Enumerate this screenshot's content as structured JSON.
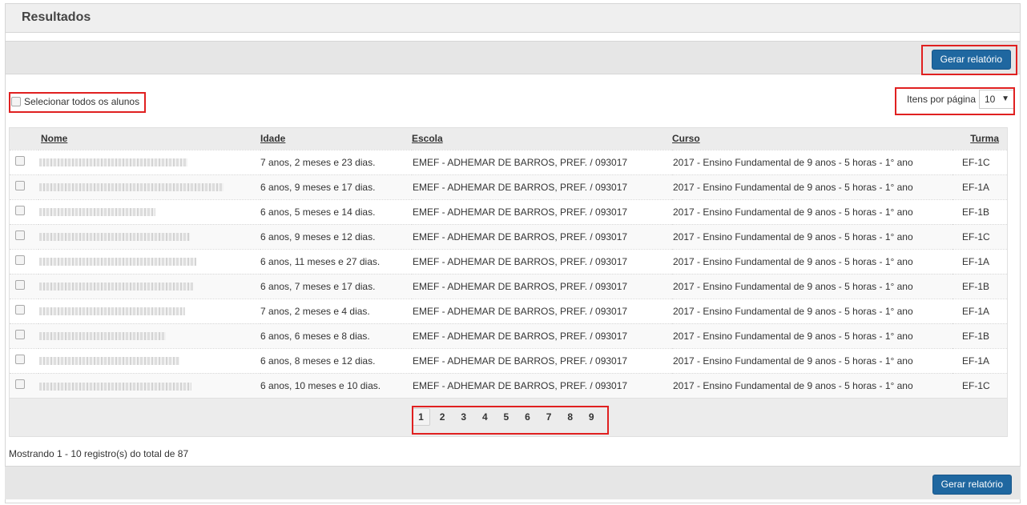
{
  "panel": {
    "title": "Resultados"
  },
  "toolbar": {
    "generate_label": "Gerar relatório"
  },
  "select_all": {
    "label": "Selecionar todos os alunos"
  },
  "per_page": {
    "label": "Itens por página",
    "value": "10"
  },
  "table": {
    "headers": {
      "nome": "Nome",
      "idade": "Idade",
      "escola": "Escola",
      "curso": "Curso",
      "turma": "Turma"
    },
    "rows": [
      {
        "idade": "7 anos, 2 meses e 23 dias.",
        "escola": "EMEF - ADHEMAR DE BARROS, PREF. / 093017",
        "curso": "2017 - Ensino Fundamental de 9 anos - 5 horas - 1° ano",
        "turma": "EF-1C"
      },
      {
        "idade": "6 anos, 9 meses e 17 dias.",
        "escola": "EMEF - ADHEMAR DE BARROS, PREF. / 093017",
        "curso": "2017 - Ensino Fundamental de 9 anos - 5 horas - 1° ano",
        "turma": "EF-1A"
      },
      {
        "idade": "6 anos, 5 meses e 14 dias.",
        "escola": "EMEF - ADHEMAR DE BARROS, PREF. / 093017",
        "curso": "2017 - Ensino Fundamental de 9 anos - 5 horas - 1° ano",
        "turma": "EF-1B"
      },
      {
        "idade": "6 anos, 9 meses e 12 dias.",
        "escola": "EMEF - ADHEMAR DE BARROS, PREF. / 093017",
        "curso": "2017 - Ensino Fundamental de 9 anos - 5 horas - 1° ano",
        "turma": "EF-1C"
      },
      {
        "idade": "6 anos, 11 meses e 27 dias.",
        "escola": "EMEF - ADHEMAR DE BARROS, PREF. / 093017",
        "curso": "2017 - Ensino Fundamental de 9 anos - 5 horas - 1° ano",
        "turma": "EF-1A"
      },
      {
        "idade": "6 anos, 7 meses e 17 dias.",
        "escola": "EMEF - ADHEMAR DE BARROS, PREF. / 093017",
        "curso": "2017 - Ensino Fundamental de 9 anos - 5 horas - 1° ano",
        "turma": "EF-1B"
      },
      {
        "idade": "7 anos, 2 meses e 4 dias.",
        "escola": "EMEF - ADHEMAR DE BARROS, PREF. / 093017",
        "curso": "2017 - Ensino Fundamental de 9 anos - 5 horas - 1° ano",
        "turma": "EF-1A"
      },
      {
        "idade": "6 anos, 6 meses e 8 dias.",
        "escola": "EMEF - ADHEMAR DE BARROS, PREF. / 093017",
        "curso": "2017 - Ensino Fundamental de 9 anos - 5 horas - 1° ano",
        "turma": "EF-1B"
      },
      {
        "idade": "6 anos, 8 meses e 12 dias.",
        "escola": "EMEF - ADHEMAR DE BARROS, PREF. / 093017",
        "curso": "2017 - Ensino Fundamental de 9 anos - 5 horas - 1° ano",
        "turma": "EF-1A"
      },
      {
        "idade": "6 anos, 10 meses e 10 dias.",
        "escola": "EMEF - ADHEMAR DE BARROS, PREF. / 093017",
        "curso": "2017 - Ensino Fundamental de 9 anos - 5 horas - 1° ano",
        "turma": "EF-1C"
      }
    ]
  },
  "pagination": {
    "pages": [
      "1",
      "2",
      "3",
      "4",
      "5",
      "6",
      "7",
      "8",
      "9"
    ],
    "active": "1"
  },
  "summary": "Mostrando 1 - 10 registro(s) do total de 87",
  "colors": {
    "primary": "#1f67a0",
    "highlight": "#e02020"
  }
}
